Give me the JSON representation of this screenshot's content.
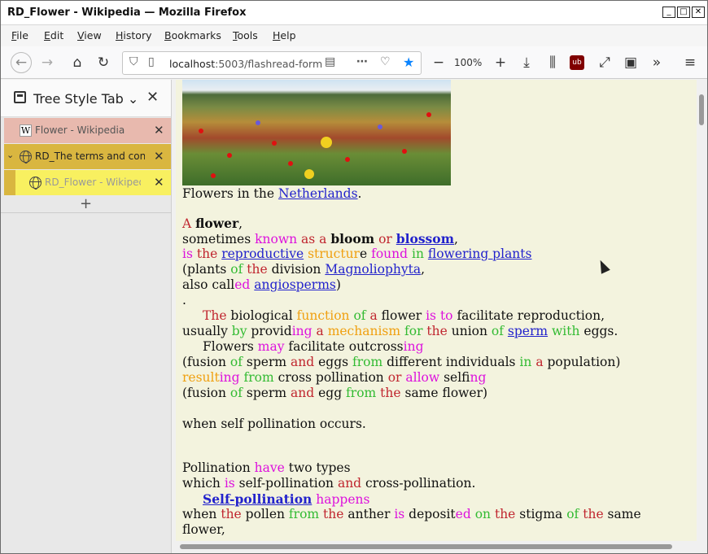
{
  "window": {
    "title": "RD_Flower - Wikipedia — Mozilla Firefox"
  },
  "menu": {
    "items": [
      "File",
      "Edit",
      "View",
      "History",
      "Bookmarks",
      "Tools",
      "Help"
    ]
  },
  "toolbar": {
    "url_host": "localhost",
    "url_rest": ":5003/flashread-form",
    "zoom": "100%"
  },
  "sidebar": {
    "title": "Tree Style Tab",
    "tabs": [
      {
        "label": "Flower - Wikipedia"
      },
      {
        "label": "RD_The terms and conditions"
      },
      {
        "label": "RD_Flower - Wikipedia"
      }
    ]
  },
  "article": {
    "caption_pre": "Flowers in the ",
    "caption_link": "Netherlands",
    "caption_post": ".",
    "lines": [
      "A flower,",
      "sometimes known as a bloom or blossom,",
      "is the reproductive structure found in flowering plants",
      "(plants of the division Magnoliophyta,",
      "also called angiosperms)",
      ".",
      "The biological function of a flower is to facilitate reproduction,",
      "usually by providing a mechanism for the union of sperm with eggs.",
      "Flowers may facilitate outcrossing",
      "(fusion of sperm and eggs from different individuals in a population)",
      "resulting from cross pollination or allow selfing",
      "(fusion of sperm and egg from the same flower)",
      "when self pollination occurs.",
      "Pollination have two types",
      "which is self-pollination and cross-pollination.",
      "Self-pollination happens",
      "when the pollen from the anther is deposited on the stigma of the same",
      "flower,"
    ]
  },
  "colors": {
    "sidebar_tab_1": "#e8b9ae",
    "sidebar_tab_2": "#d9b640",
    "sidebar_tab_3": "#f8f060",
    "content_bg": "#f3f3de"
  }
}
